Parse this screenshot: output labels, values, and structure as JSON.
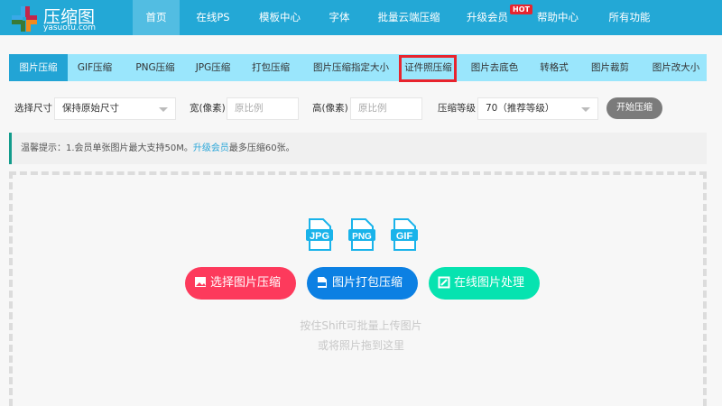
{
  "header": {
    "logo_name": "压缩图",
    "logo_url": "yasuotu.com",
    "nav": [
      {
        "label": "首页",
        "active": true
      },
      {
        "label": "在线PS"
      },
      {
        "label": "模板中心"
      },
      {
        "label": "字体"
      },
      {
        "label": "批量云端压缩"
      },
      {
        "label": "升级会员"
      },
      {
        "label": "帮助中心"
      },
      {
        "label": "所有功能"
      }
    ],
    "hot_badge": "HOT"
  },
  "tabs": [
    {
      "label": "图片压缩",
      "active": true
    },
    {
      "label": "GIF压缩"
    },
    {
      "label": "PNG压缩"
    },
    {
      "label": "JPG压缩"
    },
    {
      "label": "打包压缩"
    },
    {
      "label": "图片压缩指定大小"
    },
    {
      "label": "证件照压缩",
      "highlighted": true
    },
    {
      "label": "图片去底色"
    },
    {
      "label": "转格式"
    },
    {
      "label": "图片裁剪"
    },
    {
      "label": "图片改大小"
    }
  ],
  "form": {
    "size_label": "选择尺寸",
    "size_value": "保持原始尺寸",
    "width_label": "宽(像素)",
    "width_placeholder": "原比例",
    "height_label": "高(像素)",
    "height_placeholder": "原比例",
    "level_label": "压缩等级",
    "level_value": "70（推荐等级）",
    "start_button": "开始压缩"
  },
  "tip": {
    "prefix": "温馨提示：1.会员单张图片最大支持50M。",
    "link": "升级会员",
    "suffix": "最多压缩60张。"
  },
  "upload": {
    "formats": [
      "JPG",
      "PNG",
      "GIF"
    ],
    "buttons": [
      {
        "label": "选择图片压缩",
        "color": "#fd3a5c"
      },
      {
        "label": "图片打包压缩",
        "color": "#0c80e3"
      },
      {
        "label": "在线图片处理",
        "color": "#06e3b0"
      }
    ],
    "hint_line1": "按住Shift可批量上传图片",
    "hint_line2": "或将照片拖到这里"
  }
}
